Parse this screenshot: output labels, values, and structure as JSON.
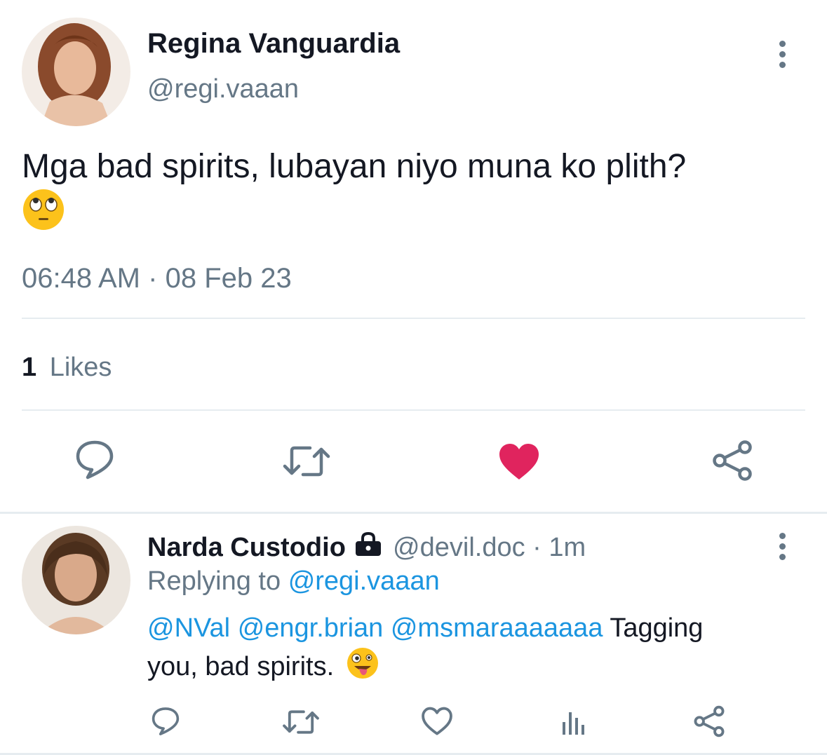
{
  "tweet": {
    "author_name": "Regina Vanguardia",
    "author_handle": "@regi.vaaan",
    "text": "Mga bad spirits, lubayan niyo muna ko plith?",
    "emoji": "face-with-rolling-eyes",
    "time": "06:48 AM",
    "separator": "·",
    "date": "08 Feb 23",
    "likes_count": "1",
    "likes_label": "Likes",
    "liked": true
  },
  "reply": {
    "author_name": "Narda Custodio",
    "author_handle": "@devil.doc",
    "separator": "·",
    "time": "1m",
    "replying_prefix": "Replying to",
    "replying_to": "@regi.vaaan",
    "mentions": [
      "@NVal",
      "@engr.brian",
      "@msmaraaaaaaa"
    ],
    "text_after_mentions": "Tagging",
    "text_line2": "you, bad spirits.",
    "emoji": "zany-face"
  },
  "icons": {
    "reply": "speech-bubble-icon",
    "retweet": "retweet-icon",
    "like": "heart-icon",
    "share": "share-icon",
    "analytics": "bar-chart-icon",
    "more": "kebab-menu-icon",
    "lock": "lock-icon"
  },
  "colors": {
    "heart_active": "#e0245e",
    "link": "#1b95e0",
    "muted": "#657786"
  }
}
